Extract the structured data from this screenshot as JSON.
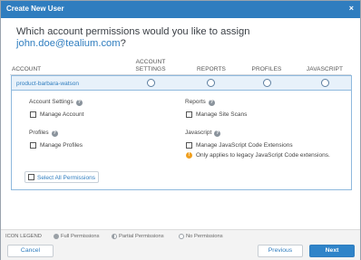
{
  "dialog": {
    "title": "Create New User",
    "close_label": "×",
    "question_prefix": "Which account permissions would you like to assign",
    "email": "john.doe@tealium.com",
    "question_suffix": "?"
  },
  "table": {
    "headers": {
      "account": "ACCOUNT",
      "account_settings_1": "ACCOUNT",
      "account_settings_2": "SETTINGS",
      "reports": "REPORTS",
      "profiles": "PROFILES",
      "javascript": "JAVASCRIPT"
    },
    "row": {
      "account_name": "product-barbara-watson"
    }
  },
  "sections": {
    "account_settings": {
      "title": "Account Settings",
      "option": "Manage Account"
    },
    "reports": {
      "title": "Reports",
      "option": "Manage Site Scans"
    },
    "profiles": {
      "title": "Profiles",
      "option": "Manage Profiles"
    },
    "javascript": {
      "title": "Javascript",
      "option": "Manage JavaScript Code Extensions",
      "note": "Only applies to legacy JavaScript Code extensions."
    }
  },
  "select_all_label": "Select All Permissions",
  "legend": {
    "title": "ICON LEGEND",
    "full": "Full Permissions",
    "partial": "Partial Permissions",
    "none": "No Permissions"
  },
  "footer": {
    "cancel": "Cancel",
    "previous": "Previous",
    "next": "Next"
  },
  "colors": {
    "accent": "#2f7dbf",
    "warning": "#f0a020"
  },
  "icons": {
    "close": "close-icon",
    "help": "question-circle-icon",
    "warning": "warning-circle-icon"
  }
}
